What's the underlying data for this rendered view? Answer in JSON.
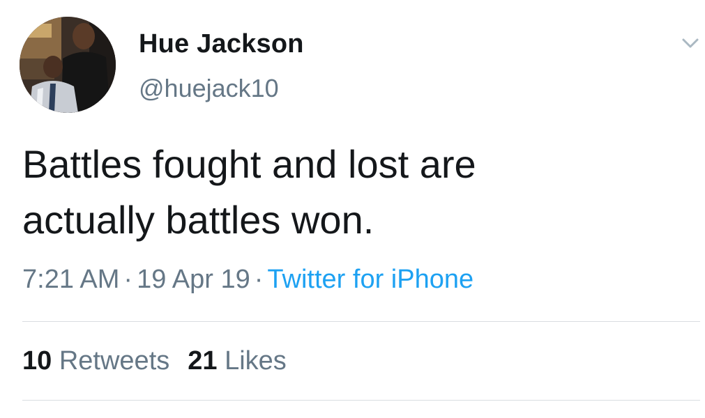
{
  "tweet": {
    "author": {
      "display_name": "Hue Jackson",
      "handle": "@huejack10",
      "avatar_icon": "profile-photo"
    },
    "menu_icon": "chevron-down-icon",
    "text_line1": "Battles fought and lost are",
    "text_line2": "actually battles won.",
    "time": "7:21 AM",
    "date": "19 Apr 19",
    "separator": "·",
    "source": "Twitter for iPhone",
    "retweets_count": "10",
    "retweets_label": "Retweets",
    "likes_count": "21",
    "likes_label": "Likes"
  },
  "colors": {
    "text": "#14171a",
    "secondary": "#657786",
    "link": "#1da1f2",
    "divider": "#d9dde0"
  }
}
